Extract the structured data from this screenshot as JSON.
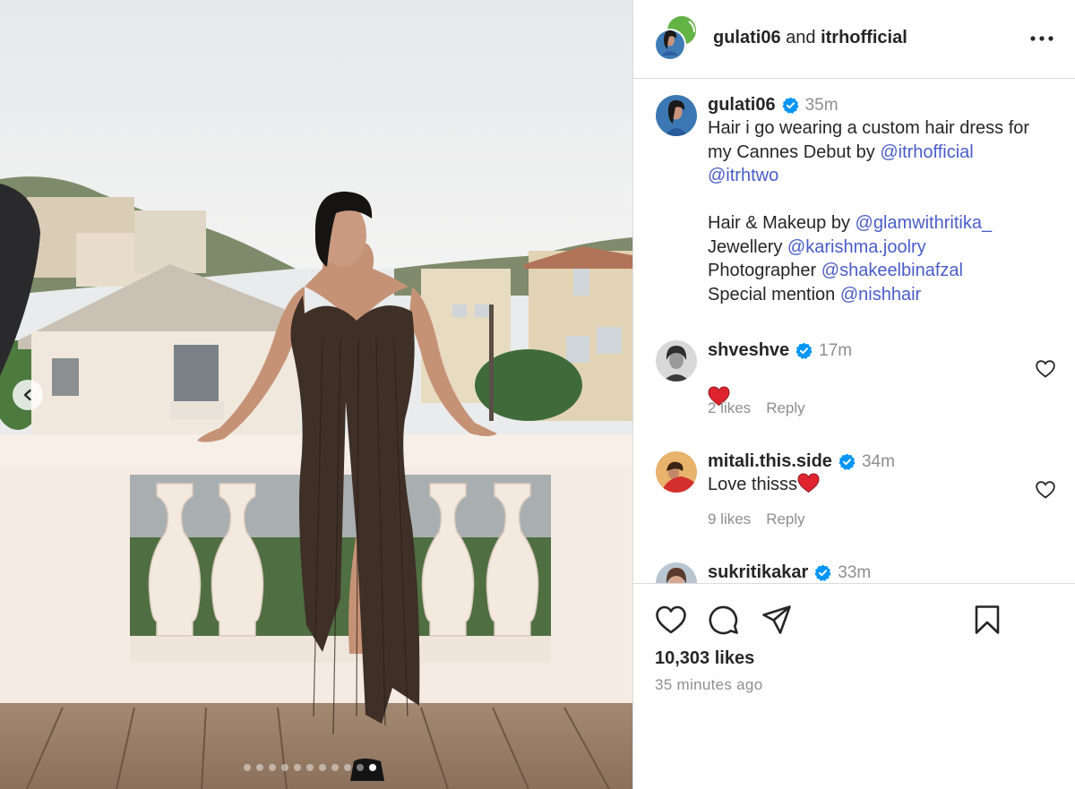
{
  "post": {
    "slide_count": 11,
    "active_slide": 11
  },
  "header": {
    "author": "gulati06",
    "connector": "and",
    "collaborator": "itrhofficial"
  },
  "caption": {
    "username": "gulati06",
    "time": "35m",
    "text_1": "Hair i go wearing a custom hair dress for my Cannes Debut by ",
    "mention_1": "@itrhofficial",
    "mention_2": "@itrhtwo",
    "line_hair_label": "Hair & Makeup by ",
    "mention_hair": "@glamwithritika_",
    "line_jewel_label": "Jewellery ",
    "mention_jewel": "@karishma.joolry",
    "line_photo_label": "Photographer ",
    "mention_photo": "@shakeelbinafzal",
    "line_special_label": "Special mention ",
    "mention_special": "@nishhair"
  },
  "comments": [
    {
      "username": "shveshve",
      "time": "17m",
      "text": "",
      "emoji": "red-heart",
      "likes": "2 likes",
      "reply": "Reply"
    },
    {
      "username": "mitali.this.side",
      "time": "34m",
      "text": "Love thisss",
      "emoji": "red-heart",
      "likes": "9 likes",
      "reply": "Reply"
    },
    {
      "username": "sukritikakar",
      "time": "33m"
    }
  ],
  "footer": {
    "likes": "10,303 likes",
    "posted": "35 minutes ago"
  },
  "colors": {
    "text": "#262626",
    "muted": "#8e8e8e",
    "link": "#4a5dc8",
    "verified": "#0095f6",
    "heart": "#ed4956",
    "border": "#dbdbdb"
  },
  "icons": [
    "chevron-left-icon",
    "more-icon",
    "verified-icon",
    "heart-icon",
    "comment-icon",
    "share-icon",
    "bookmark-icon"
  ]
}
